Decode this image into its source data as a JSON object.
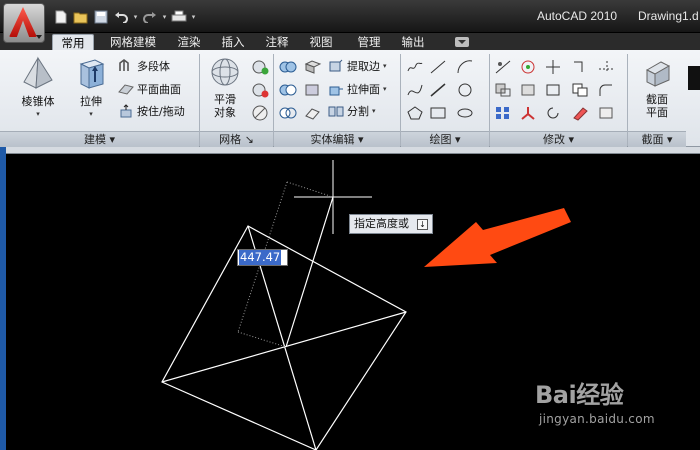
{
  "titlebar": {
    "app": "AutoCAD 2010",
    "file": "Drawing1.d",
    "quick_access": [
      "new-icon",
      "open-icon",
      "save-icon",
      "undo-icon",
      "redo-icon",
      "print-icon"
    ]
  },
  "tabs": [
    "常用",
    "网格建模",
    "渲染",
    "插入",
    "注释",
    "视图",
    "管理",
    "输出"
  ],
  "active_tab": "常用",
  "ribbon": {
    "modeling": {
      "panel_title": "建模",
      "cone": "棱锥体",
      "extrude": "拉伸",
      "polysolid": "多段体",
      "planesurf": "平面曲面",
      "presspull": "按住/拖动"
    },
    "mesh": {
      "panel_title": "网格",
      "smooth_line1": "平滑",
      "smooth_line2": "对象"
    },
    "solid_edit": {
      "panel_title": "实体编辑",
      "extract_edges": "提取边",
      "extrude_face": "拉伸面",
      "separate": "分割"
    },
    "draw": {
      "panel_title": "绘图"
    },
    "modify": {
      "panel_title": "修改"
    },
    "section": {
      "panel_title": "截面",
      "plane_line1": "截面",
      "plane_line2": "平面"
    }
  },
  "canvas": {
    "prompt": "指定高度或",
    "dynamic_value": "447.47"
  },
  "watermark": {
    "logo": "Bai经验",
    "url": "jingyan.baidu.com"
  },
  "colors": {
    "annotation_arrow": "#ff4a12",
    "canvas_bg": "#000000",
    "ribbon_bg": "#e6eaef"
  }
}
